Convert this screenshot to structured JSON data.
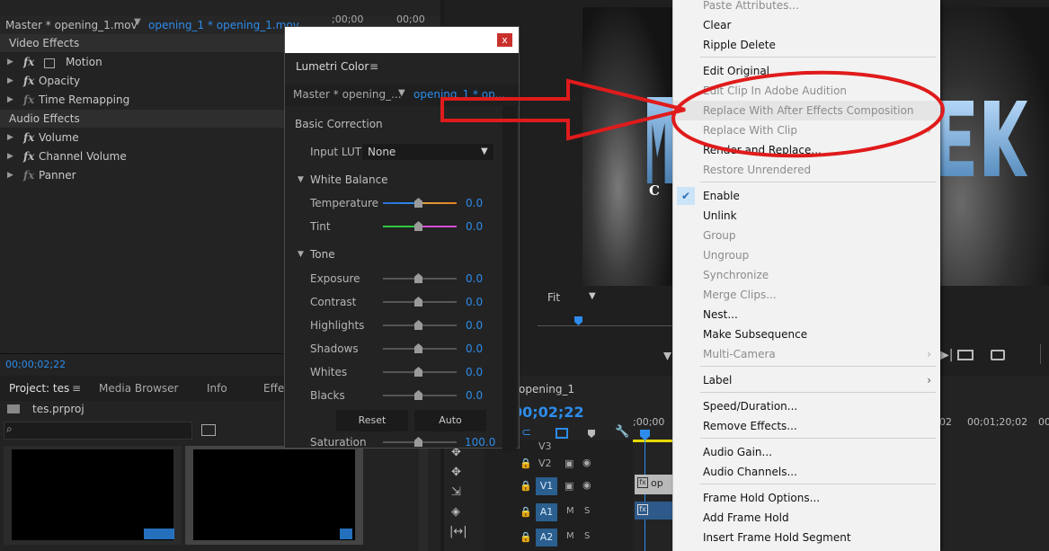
{
  "effect_controls": {
    "tab_master": "Master * opening_1.mov",
    "tab_clip": "opening_1 * opening_1.mov",
    "ruler_time_1": ";00;00",
    "ruler_time_2": "00;00",
    "video_effects": "Video Effects",
    "audio_effects": "Audio Effects",
    "video_items": [
      "Motion",
      "Opacity",
      "Time Remapping"
    ],
    "audio_items": [
      "Volume",
      "Channel Volume",
      "Panner"
    ],
    "timecode": "00;00;02;22"
  },
  "lumetri": {
    "close_label": "x",
    "panel_title": "Lumetri Color",
    "tab_master": "Master * opening_...",
    "tab_clip": "opening_1 * op...",
    "basic_correction": "Basic Correction",
    "input_lut_label": "Input LUT",
    "input_lut_value": "None",
    "white_balance": "White Balance",
    "tone": "Tone",
    "sliders": [
      {
        "label": "Temperature",
        "value": "0.0"
      },
      {
        "label": "Tint",
        "value": "0.0"
      },
      {
        "label": "Exposure",
        "value": "0.0"
      },
      {
        "label": "Contrast",
        "value": "0.0"
      },
      {
        "label": "Highlights",
        "value": "0.0"
      },
      {
        "label": "Shadows",
        "value": "0.0"
      },
      {
        "label": "Whites",
        "value": "0.0"
      },
      {
        "label": "Blacks",
        "value": "0.0"
      },
      {
        "label": "Saturation",
        "value": "100.0"
      }
    ],
    "reset_label": "Reset",
    "auto_label": "Auto"
  },
  "program_monitor": {
    "zoom_label": "Fit",
    "timecode_fragment": "2",
    "title_letter_c": "C"
  },
  "context_menu": {
    "items": [
      {
        "label": "Paste Attributes...",
        "disabled": true
      },
      {
        "label": "Clear",
        "disabled": false
      },
      {
        "label": "Ripple Delete",
        "disabled": false
      },
      {
        "label": "Edit Original",
        "disabled": false
      },
      {
        "label": "Edit Clip In Adobe Audition",
        "disabled": true
      },
      {
        "label": "Replace With After Effects Composition",
        "disabled": true,
        "highlighted": true
      },
      {
        "label": "Replace With Clip",
        "disabled": true,
        "submenu": true
      },
      {
        "label": "Render and Replace...",
        "disabled": false
      },
      {
        "label": "Restore Unrendered",
        "disabled": true
      },
      {
        "label": "Enable",
        "disabled": false,
        "checked": true
      },
      {
        "label": "Unlink",
        "disabled": false
      },
      {
        "label": "Group",
        "disabled": true
      },
      {
        "label": "Ungroup",
        "disabled": true
      },
      {
        "label": "Synchronize",
        "disabled": true
      },
      {
        "label": "Merge Clips...",
        "disabled": true
      },
      {
        "label": "Nest...",
        "disabled": false
      },
      {
        "label": "Make Subsequence",
        "disabled": false
      },
      {
        "label": "Multi-Camera",
        "disabled": true,
        "submenu": true
      },
      {
        "label": "Label",
        "disabled": false,
        "submenu": true
      },
      {
        "label": "Speed/Duration...",
        "disabled": false
      },
      {
        "label": "Remove Effects...",
        "disabled": false
      },
      {
        "label": "Audio Gain...",
        "disabled": false
      },
      {
        "label": "Audio Channels...",
        "disabled": false
      },
      {
        "label": "Frame Hold Options...",
        "disabled": false
      },
      {
        "label": "Add Frame Hold",
        "disabled": false
      },
      {
        "label": "Insert Frame Hold Segment",
        "disabled": false
      }
    ]
  },
  "project": {
    "tab_project": "Project: tes",
    "tab_media_browser": "Media Browser",
    "tab_info": "Info",
    "tab_effects": "Effe",
    "file_name": "tes.prproj"
  },
  "timeline": {
    "sequence_name": "opening_1",
    "timecode": "00;02;22",
    "ruler_start": ";00;00",
    "ruler_mid": "02",
    "ruler_end": "00;01;20;02",
    "ruler_far": "00;",
    "tracks": [
      "V3",
      "V2",
      "V1",
      "A1",
      "A2"
    ],
    "clip_label": "op",
    "mute_label": "M",
    "solo_label": "S"
  },
  "colors": {
    "accent_blue": "#2d8ceb",
    "annotation_red": "#e01b1b",
    "menu_bg": "#f2f2f2"
  }
}
